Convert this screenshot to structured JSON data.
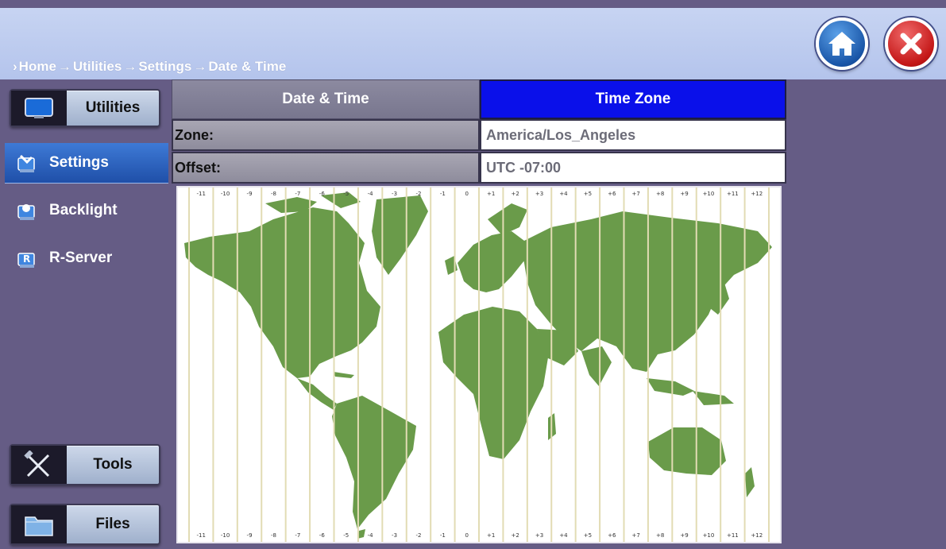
{
  "breadcrumb": [
    "Home",
    "Utilities",
    "Settings",
    "Date & Time"
  ],
  "header": {
    "home_icon": "home-icon",
    "close_icon": "close-icon"
  },
  "sidebar": {
    "top_button": {
      "label": "Utilities",
      "icon": "monitor-icon"
    },
    "items": [
      {
        "label": "Settings",
        "icon": "settings-icon",
        "active": true
      },
      {
        "label": "Backlight",
        "icon": "backlight-icon",
        "active": false
      },
      {
        "label": "R-Server",
        "icon": "r-server-icon",
        "active": false
      }
    ],
    "bottom_buttons": [
      {
        "label": "Tools",
        "icon": "tools-icon"
      },
      {
        "label": "Files",
        "icon": "folder-icon"
      }
    ]
  },
  "tabs": [
    {
      "label": "Date & Time",
      "active": false
    },
    {
      "label": "Time Zone",
      "active": true
    }
  ],
  "fields": {
    "zone": {
      "label": "Zone:",
      "value": "America/Los_Angeles"
    },
    "offset": {
      "label": "Offset:",
      "value": "UTC -07:00"
    }
  },
  "map": {
    "offset_labels": [
      "-11",
      "-10",
      "-9",
      "-8",
      "-7",
      "-6",
      "-5",
      "-4",
      "-3",
      "-2",
      "-1",
      "0",
      "+1",
      "+2",
      "+3",
      "+4",
      "+5",
      "+6",
      "+7",
      "+8",
      "+9",
      "+10",
      "+11",
      "+12"
    ]
  },
  "colors": {
    "active_tab": "#0a10ea",
    "active_nav": "#2a5fc0",
    "land": "#6a9b4a",
    "background": "#655c85"
  }
}
